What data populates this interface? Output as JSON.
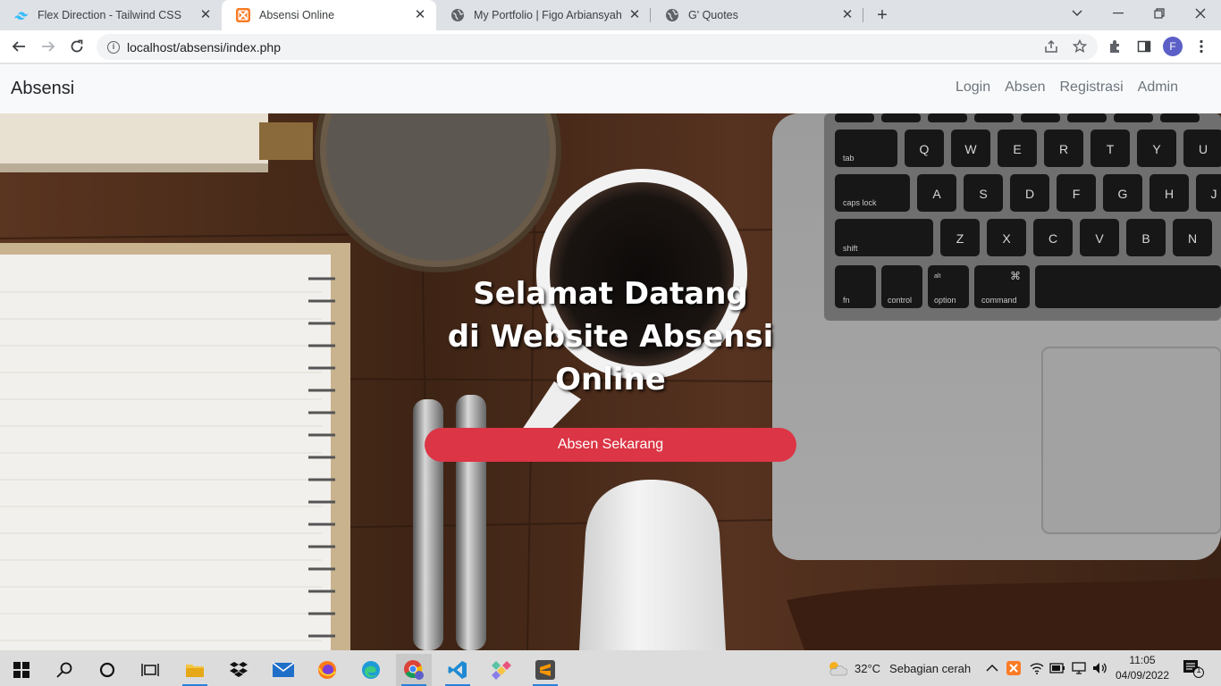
{
  "browser": {
    "tabs": [
      {
        "title": "Flex Direction - Tailwind CSS",
        "icon": "tailwind-icon"
      },
      {
        "title": "Absensi Online",
        "icon": "xampp-icon",
        "active": true
      },
      {
        "title": "My Portfolio | Figo Arbiansyah",
        "icon": "globe-icon"
      },
      {
        "title": "G' Quotes",
        "icon": "globe-icon"
      }
    ],
    "new_tab": "+",
    "url": "localhost/absensi/index.php",
    "profile_initial": "F"
  },
  "page": {
    "brand": "Absensi",
    "nav": [
      "Login",
      "Absen",
      "Registrasi",
      "Admin"
    ],
    "hero": {
      "title_lines": [
        "Selamat Datang",
        "di Website Absensi",
        "Online"
      ],
      "button": "Absen Sekarang"
    }
  },
  "keyboard": {
    "row1": [
      "Q",
      "W",
      "E",
      "R",
      "T",
      "Y",
      "U"
    ],
    "row2": [
      "A",
      "S",
      "D",
      "F",
      "G",
      "H",
      "J"
    ],
    "row3": [
      "Z",
      "X",
      "C",
      "V",
      "B",
      "N"
    ],
    "mods": {
      "tab": "tab",
      "caps": "caps lock",
      "shift": "shift",
      "fn": "fn",
      "control": "control",
      "alt": "alt",
      "option": "option",
      "cmd_symbol": "⌘",
      "command": "command"
    }
  },
  "taskbar": {
    "weather_temp": "32°C",
    "weather_text": "Sebagian cerah",
    "time": "11:05",
    "date": "04/09/2022",
    "notification_count": "1"
  },
  "colors": {
    "accent_button": "#dc3545",
    "navbar_bg": "#f8f9fa",
    "nav_link": "#6c757d"
  }
}
